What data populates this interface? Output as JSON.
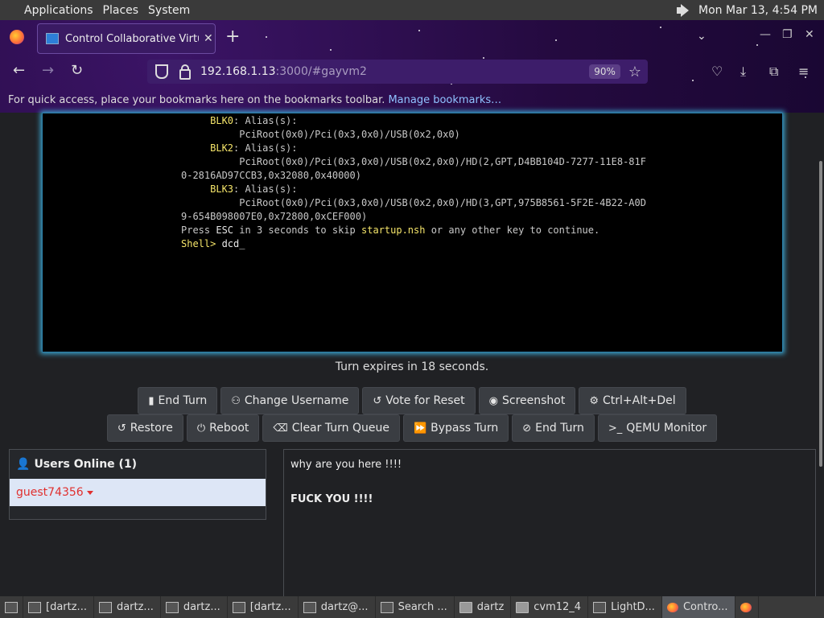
{
  "top_panel": {
    "menus": [
      "Applications",
      "Places",
      "System"
    ],
    "datetime": "Mon Mar 13,  4:54 PM"
  },
  "browser": {
    "tab_title": "Control Collaborative Virtua",
    "tab_close": "✕",
    "new_tab": "+",
    "url_host": "192.168.1.13",
    "url_rest": ":3000/#gayvm2",
    "zoom": "90%",
    "bookmarks_message": "For quick access, place your bookmarks here on the bookmarks toolbar.",
    "manage_bookmarks": "Manage bookmarks…"
  },
  "vm_terminal": {
    "lines": [
      {
        "indent": "     ",
        "label": "BLK0",
        "rest": ": Alias(s):"
      },
      {
        "indent": "          ",
        "label": "",
        "rest": "PciRoot(0x0)/Pci(0x3,0x0)/USB(0x2,0x0)"
      },
      {
        "indent": "     ",
        "label": "BLK2",
        "rest": ": Alias(s):"
      },
      {
        "indent": "          ",
        "label": "",
        "rest": "PciRoot(0x0)/Pci(0x3,0x0)/USB(0x2,0x0)/HD(2,GPT,D4BB104D-7277-11E8-81F"
      },
      {
        "indent": "",
        "label": "",
        "rest": "0-2816AD97CCB3,0x32080,0x40000)"
      },
      {
        "indent": "     ",
        "label": "BLK3",
        "rest": ": Alias(s):"
      },
      {
        "indent": "          ",
        "label": "",
        "rest": "PciRoot(0x0)/Pci(0x3,0x0)/USB(0x2,0x0)/HD(3,GPT,975B8561-5F2E-4B22-A0D"
      },
      {
        "indent": "",
        "label": "",
        "rest": "9-654B098007E0,0x72800,0xCEF000)"
      }
    ],
    "press_line": {
      "a": "Press ",
      "esc": "ESC",
      "b": " in 3 seconds to skip ",
      "file": "startup.nsh",
      "c": " or any other key to continue."
    },
    "prompt": "Shell> ",
    "input": "dcd_"
  },
  "turn_status": "Turn expires in 18 seconds.",
  "buttons_row1": [
    {
      "icon": "mouse-icon",
      "glyph": "▮",
      "label": "End Turn"
    },
    {
      "icon": "user-edit-icon",
      "glyph": "⚇",
      "label": "Change Username"
    },
    {
      "icon": "undo-icon",
      "glyph": "↺",
      "label": "Vote for Reset"
    },
    {
      "icon": "camera-icon",
      "glyph": "◉",
      "label": "Screenshot"
    },
    {
      "icon": "gear-icon",
      "glyph": "⚙",
      "label": "Ctrl+Alt+Del"
    }
  ],
  "buttons_row2": [
    {
      "icon": "restore-icon",
      "glyph": "↺",
      "label": "Restore"
    },
    {
      "icon": "power-icon",
      "glyph": "⏻",
      "label": "Reboot"
    },
    {
      "icon": "eraser-icon",
      "glyph": "⌫",
      "label": "Clear Turn Queue"
    },
    {
      "icon": "fast-forward-icon",
      "glyph": "⏩",
      "label": "Bypass Turn"
    },
    {
      "icon": "ban-icon",
      "glyph": "⊘",
      "label": "End Turn"
    },
    {
      "icon": "terminal-icon",
      "glyph": ">_",
      "label": "QEMU Monitor"
    }
  ],
  "users": {
    "header": "Users Online (1)",
    "list": [
      "guest74356"
    ]
  },
  "chat": {
    "messages": [
      "why are you here !!!!",
      "FUCK YOU !!!!"
    ]
  },
  "taskbar": [
    {
      "icon": "terminal-icon",
      "label": "[dartz..."
    },
    {
      "icon": "terminal-icon",
      "label": "dartz..."
    },
    {
      "icon": "terminal-icon",
      "label": "dartz..."
    },
    {
      "icon": "terminal-icon",
      "label": "[dartz..."
    },
    {
      "icon": "terminal-icon",
      "label": "dartz@..."
    },
    {
      "icon": "search-icon",
      "label": "Search ..."
    },
    {
      "icon": "folder-icon",
      "label": "dartz"
    },
    {
      "icon": "folder-icon",
      "label": "cvm12_4"
    },
    {
      "icon": "window-icon",
      "label": "LightD..."
    },
    {
      "icon": "firefox-icon",
      "label": "Contro..."
    }
  ]
}
